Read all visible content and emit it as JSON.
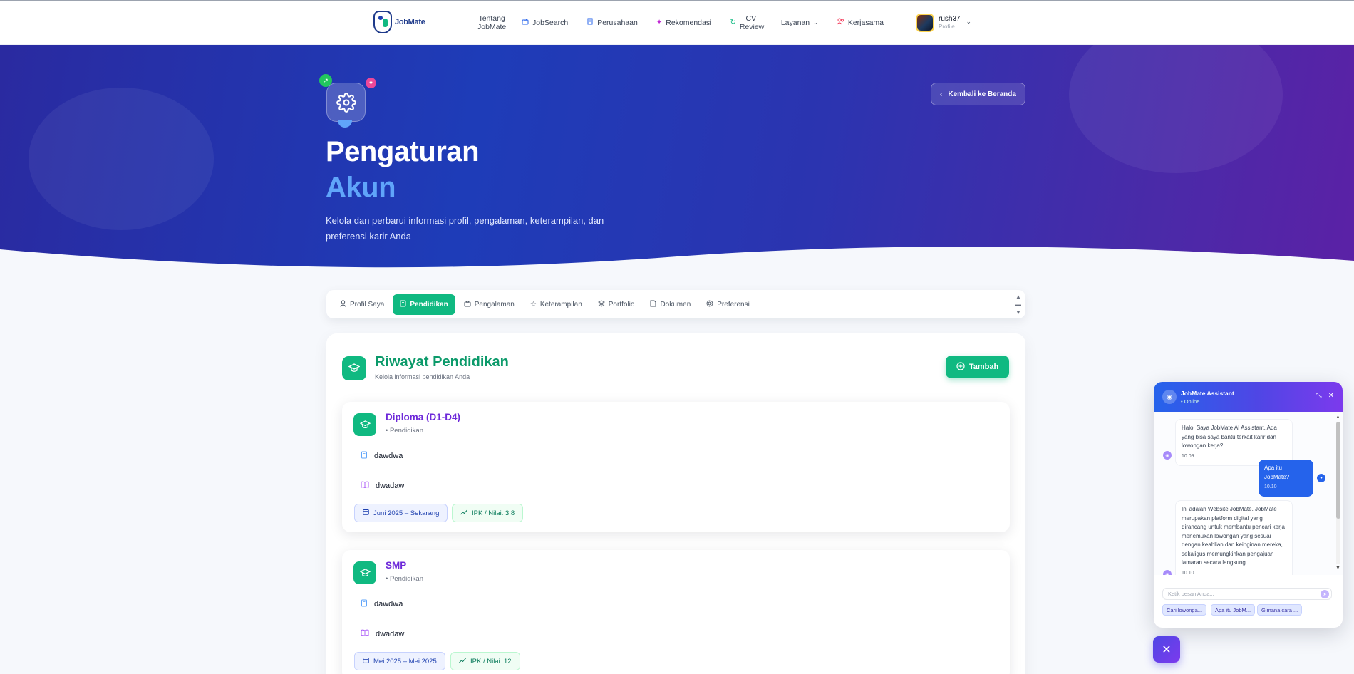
{
  "nav": {
    "logo_text": "JobMate",
    "items": [
      {
        "label": "Tentang JobMate",
        "icon": ""
      },
      {
        "label": "JobSearch",
        "icon": "briefcase-icon"
      },
      {
        "label": "Perusahaan",
        "icon": "building-icon"
      },
      {
        "label": "Rekomendasi",
        "icon": "sparkle-icon"
      },
      {
        "label": "CV Review",
        "icon": "refresh-icon"
      },
      {
        "label": "Layanan",
        "icon": "chevron-down-icon"
      },
      {
        "label": "Kerjasama",
        "icon": "handshake-icon"
      }
    ],
    "profile": {
      "name": "rush37",
      "sub": "Profile"
    }
  },
  "hero": {
    "title_line1": "Pengaturan",
    "title_line2": "Akun",
    "description": "Kelola dan perbarui informasi profil, pengalaman, keterampilan, dan preferensi karir Anda",
    "back_button": "Kembali ke Beranda",
    "accent_color": "#60a5fa"
  },
  "tabs": [
    {
      "label": "Profil Saya",
      "icon": "user-icon",
      "active": false
    },
    {
      "label": "Pendidikan",
      "icon": "book-icon",
      "active": true
    },
    {
      "label": "Pengalaman",
      "icon": "briefcase-icon",
      "active": false
    },
    {
      "label": "Keterampilan",
      "icon": "star-icon",
      "active": false
    },
    {
      "label": "Portfolio",
      "icon": "layers-icon",
      "active": false
    },
    {
      "label": "Dokumen",
      "icon": "document-icon",
      "active": false
    },
    {
      "label": "Preferensi",
      "icon": "target-icon",
      "active": false
    }
  ],
  "section": {
    "title": "Riwayat Pendidikan",
    "subtitle": "Kelola informasi pendidikan Anda",
    "add_button": "Tambah",
    "brand_color": "#10b981"
  },
  "education": [
    {
      "level": "Diploma (D1-D4)",
      "type": "Pendidikan",
      "institution": "dawdwa",
      "major": "dwadaw",
      "period": "Juni 2025 – Sekarang",
      "score": "IPK / Nilai: 3.8"
    },
    {
      "level": "SMP",
      "type": "Pendidikan",
      "institution": "dawdwa",
      "major": "dwadaw",
      "period": "Mei 2025 – Mei 2025",
      "score": "IPK / Nilai: 12"
    }
  ],
  "chat": {
    "title": "JobMate Assistant",
    "status": "Online",
    "messages": [
      {
        "from": "bot",
        "text": "Halo! Saya JobMate AI Assistant. Ada yang bisa saya bantu terkait karir dan lowongan kerja?",
        "time": "10.09"
      },
      {
        "from": "user",
        "text": "Apa itu JobMate?",
        "time": "10.10"
      },
      {
        "from": "bot",
        "text": "Ini adalah Website JobMate. JobMate merupakan platform digital yang dirancang untuk membantu pencari kerja menemukan lowongan yang sesuai dengan keahlian dan keinginan mereka, sekaligus memungkinkan pengajuan lamaran secara langsung.",
        "time": "10.10"
      }
    ],
    "input_placeholder": "Ketik pesan Anda...",
    "quick_replies": [
      "Cari lowonga...",
      "Apa itu JobM...",
      "Gimana cara ..."
    ]
  }
}
